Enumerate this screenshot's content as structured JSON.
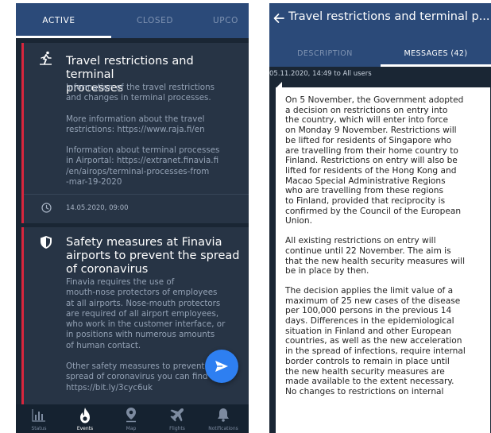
{
  "left": {
    "tabs": [
      {
        "label": "ACTIVE",
        "active": true
      },
      {
        "label": "CLOSED",
        "active": false
      },
      {
        "label": "UPCO",
        "active": false
      }
    ],
    "cards": [
      {
        "icon": "walking-person-icon",
        "title_lines": [
          "Travel restrictions and terminal",
          "processes"
        ],
        "paragraphs": [
          [
            "Information of the travel restrictions",
            "and changes in terminal processes."
          ],
          [
            "More information about the travel",
            "restrictions: https://www.raja.fi/en"
          ],
          [
            "Information about terminal processes",
            "in Airportal: https://extranet.finavia.fi",
            "/en/airops/terminal-processes-from",
            "-mar-19-2020"
          ]
        ],
        "date": "14.05.2020, 09:00"
      },
      {
        "icon": "shield-icon",
        "title_lines": [
          "Safety measures at Finavia",
          "airports to prevent the spread",
          "of coronavirus"
        ],
        "paragraphs": [
          [
            "Finavia requires the use of",
            "mouth-nose protectors of employees",
            "at all airports. Nose-mouth protectors",
            "are required of all airport employees,",
            "who work in the customer interface, or",
            "in positions with numerous amounts",
            "of human contact."
          ],
          [
            "Other safety measures to prevent",
            "spread of coronavirus you can find",
            "https://bit.ly/3cyc6uk"
          ]
        ]
      }
    ],
    "nav": [
      {
        "label": "Status",
        "icon": "bar-chart-icon",
        "active": false
      },
      {
        "label": "Events",
        "icon": "flame-icon",
        "active": true
      },
      {
        "label": "Map",
        "icon": "map-pin-icon",
        "active": false
      },
      {
        "label": "Flights",
        "icon": "airplane-icon",
        "active": false
      },
      {
        "label": "Notifications",
        "icon": "bell-icon",
        "active": false
      }
    ],
    "fab_icon": "send-icon"
  },
  "right": {
    "title": "Travel restrictions and terminal p...",
    "tabs": [
      {
        "label": "DESCRIPTION",
        "active": false
      },
      {
        "label": "MESSAGES (42)",
        "active": true
      }
    ],
    "meta": "05.11.2020, 14:49 to All users",
    "paragraphs": [
      [
        "On 5 November, the Government adopted",
        "a decision on restrictions on entry into",
        "the country, which will enter into force",
        "on Monday 9 November. Restrictions will",
        "be lifted for residents of Singapore who",
        "are travelling from their home country to",
        "Finland. Restrictions on entry will also be",
        "lifted for residents of the Hong Kong and",
        "Macao Special Administrative Regions",
        "who are travelling from these regions",
        "to Finland, provided that reciprocity is",
        "confirmed by the Council of the European",
        "Union."
      ],
      [
        "All existing restrictions on entry will",
        "continue until 22 November. The aim is",
        "that the new health security measures will",
        "be in place by then."
      ],
      [
        "The decision applies the limit value of a",
        "maximum of 25 new cases of the disease",
        "per 100,000 persons in the previous 14",
        "days. Differences in the epidemiological",
        "situation in Finland and other European",
        "countries, as well as the new acceleration",
        "in the spread of infections, require internal",
        "border controls to remain in place until",
        "the new health security measures are",
        "made available to the extent necessary.",
        "No changes to restrictions on internal"
      ]
    ]
  },
  "colors": {
    "header_blue": "#2b4a79",
    "background_dark": "#1a2634",
    "card_bg": "#273445",
    "accent_red": "#d8263d",
    "fab_blue": "#2e7ff1"
  }
}
